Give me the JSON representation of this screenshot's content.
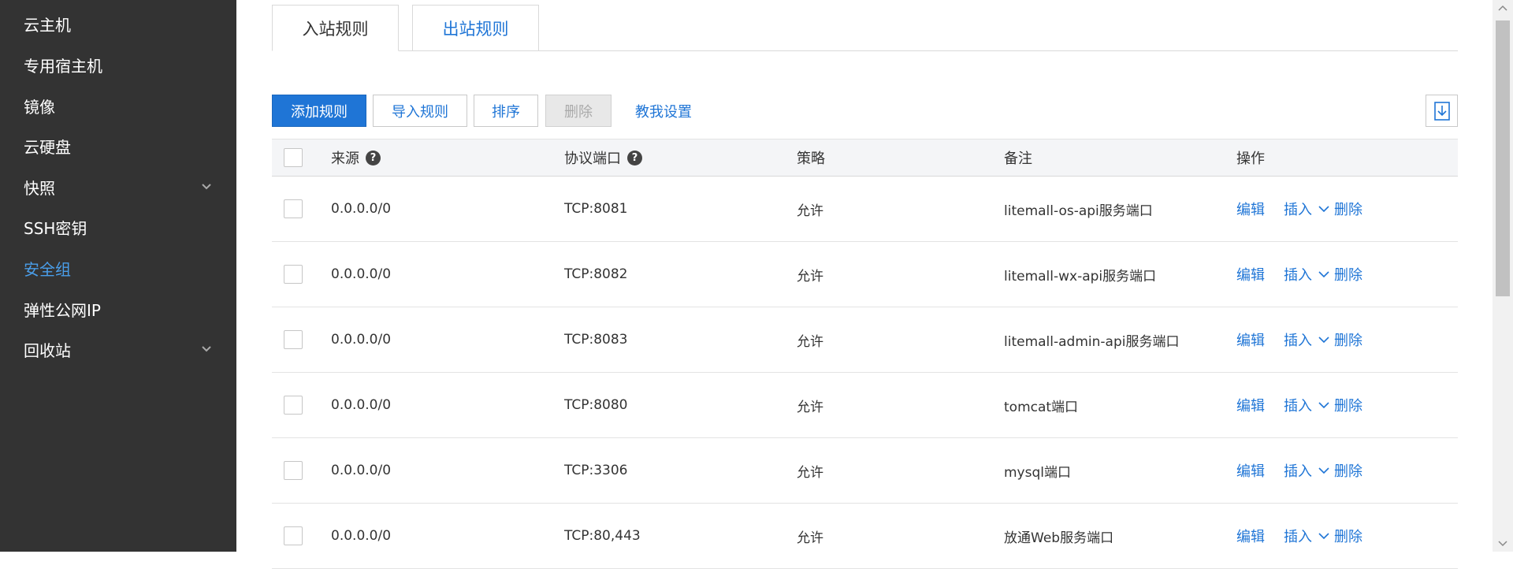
{
  "sidebar": {
    "items": [
      {
        "label": "云主机"
      },
      {
        "label": "专用宿主机"
      },
      {
        "label": "镜像"
      },
      {
        "label": "云硬盘"
      },
      {
        "label": "快照"
      },
      {
        "label": "SSH密钥"
      },
      {
        "label": "安全组"
      },
      {
        "label": "弹性公网IP"
      },
      {
        "label": "回收站"
      }
    ],
    "active_color": "#4a9eea",
    "background": "#333333"
  },
  "tabs": [
    {
      "label": "入站规则"
    },
    {
      "label": "出站规则"
    }
  ],
  "toolbar": {
    "add_label": "添加规则",
    "import_label": "导入规则",
    "sort_label": "排序",
    "delete_label": "删除",
    "guide_label": "教我设置",
    "export_icon": "download-icon"
  },
  "table": {
    "headers": {
      "source": "来源",
      "protocol_port": "协议端口",
      "policy": "策略",
      "remark": "备注",
      "actions": "操作"
    },
    "help_glyph": "?",
    "rows": [
      {
        "source": "0.0.0.0/0",
        "port": "TCP:8081",
        "policy": "允许",
        "remark": "litemall-os-api服务端口"
      },
      {
        "source": "0.0.0.0/0",
        "port": "TCP:8082",
        "policy": "允许",
        "remark": "litemall-wx-api服务端口"
      },
      {
        "source": "0.0.0.0/0",
        "port": "TCP:8083",
        "policy": "允许",
        "remark": "litemall-admin-api服务端口"
      },
      {
        "source": "0.0.0.0/0",
        "port": "TCP:8080",
        "policy": "允许",
        "remark": "tomcat端口"
      },
      {
        "source": "0.0.0.0/0",
        "port": "TCP:3306",
        "policy": "允许",
        "remark": "mysql端口"
      },
      {
        "source": "0.0.0.0/0",
        "port": "TCP:80,443",
        "policy": "允许",
        "remark": "放通Web服务端口"
      }
    ],
    "row_actions": {
      "edit": "编辑",
      "insert": "插入",
      "delete": "删除"
    }
  },
  "colors": {
    "accent": "#1f75d6"
  }
}
